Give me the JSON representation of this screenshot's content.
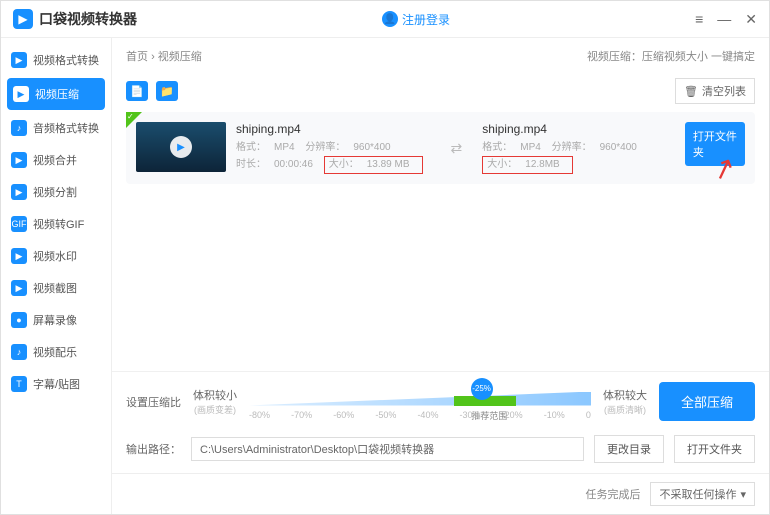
{
  "app_title": "口袋视频转换器",
  "login": "注册登录",
  "win": {
    "menu": "≡",
    "min": "—",
    "close": "✕"
  },
  "sidebar": {
    "items": [
      {
        "label": "视频格式转换",
        "icon": "▶"
      },
      {
        "label": "视频压缩",
        "icon": "▶"
      },
      {
        "label": "音频格式转换",
        "icon": "♪"
      },
      {
        "label": "视频合并",
        "icon": "▶"
      },
      {
        "label": "视频分割",
        "icon": "▶"
      },
      {
        "label": "视频转GIF",
        "icon": "GIF"
      },
      {
        "label": "视频水印",
        "icon": "▶"
      },
      {
        "label": "视频截图",
        "icon": "▶"
      },
      {
        "label": "屏幕录像",
        "icon": "●"
      },
      {
        "label": "视频配乐",
        "icon": "♪"
      },
      {
        "label": "字幕/贴图",
        "icon": "T"
      }
    ]
  },
  "breadcrumb": {
    "home": "首页",
    "sep": "›",
    "current": "视频压缩",
    "tip": "视频压缩：压缩视频大小 一键搞定"
  },
  "toolbar": {
    "clear": "清空列表"
  },
  "file": {
    "src": {
      "name": "shiping.mp4",
      "format_label": "格式：",
      "format": "MP4",
      "res_label": "分辨率：",
      "res": "960*400",
      "dur_label": "时长：",
      "dur": "00:00:46",
      "size_label": "大小：",
      "size": "13.89 MB"
    },
    "dst": {
      "name": "shiping.mp4",
      "format_label": "格式：",
      "format": "MP4",
      "res_label": "分辨率：",
      "res": "960*400",
      "size_label": "大小：",
      "size": "12.8MB"
    },
    "open": "打开文件夹"
  },
  "slider": {
    "label": "设置压缩比",
    "small": "体积较小",
    "small_sub": "(画质变差)",
    "large": "体积较大",
    "large_sub": "(画质清晰)",
    "value": "-25%",
    "recommend": "推荐范围",
    "marks": [
      "-80%",
      "-70%",
      "-60%",
      "-50%",
      "-40%",
      "-30%",
      "-20%",
      "-10%",
      "0"
    ]
  },
  "compress_btn": "全部压缩",
  "output": {
    "label": "输出路径：",
    "path": "C:\\Users\\Administrator\\Desktop\\口袋视频转换器",
    "change": "更改目录",
    "open": "打开文件夹"
  },
  "footer": {
    "label": "任务完成后",
    "option": "不采取任何操作"
  }
}
